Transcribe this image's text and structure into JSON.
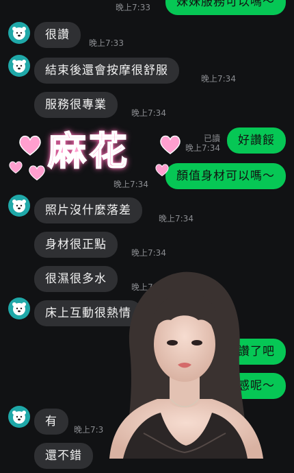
{
  "messages": [
    {
      "dir": "out",
      "text": "妹妹服務可以嗎～",
      "time": "晚上7:33"
    },
    {
      "dir": "in",
      "text": "很讚",
      "time": "晚上7:33"
    },
    {
      "dir": "in",
      "text": "結束後還會按摩很舒服",
      "time": "晚上7:34"
    },
    {
      "dir": "in",
      "text": "服務很專業",
      "time": "晚上7:34"
    },
    {
      "dir": "out",
      "text": "好讚餒",
      "read": "已讀",
      "time": "晚上7:34"
    },
    {
      "dir": "out",
      "text": "顏值身材可以嗎～",
      "time": "晚上7:34"
    },
    {
      "dir": "in",
      "text": "照片沒什麼落差",
      "time": "晚上7:34"
    },
    {
      "dir": "in",
      "text": "身材很正點",
      "time": "晚上7:34"
    },
    {
      "dir": "in",
      "text": "很濕很多水",
      "time": "晚上7:34"
    },
    {
      "dir": "in",
      "text": "床上互動很熱情",
      "time": ""
    },
    {
      "dir": "out",
      "text": "太讚了吧",
      "time": ""
    },
    {
      "dir": "out",
      "text": "女友感呢～",
      "time": ""
    },
    {
      "dir": "in",
      "text": "有",
      "time": "晚上7:3"
    },
    {
      "dir": "in",
      "text": "還不錯",
      "time": ""
    }
  ],
  "overlay_title": "麻花",
  "colors": {
    "background": "#111214",
    "incoming": "#2f3033",
    "outgoing": "#06c755",
    "avatar": "#1fa8a8",
    "title_pink": "#ff9fcf"
  },
  "icons": {
    "avatar": "bear-face-icon",
    "heart": "heart-icon"
  }
}
